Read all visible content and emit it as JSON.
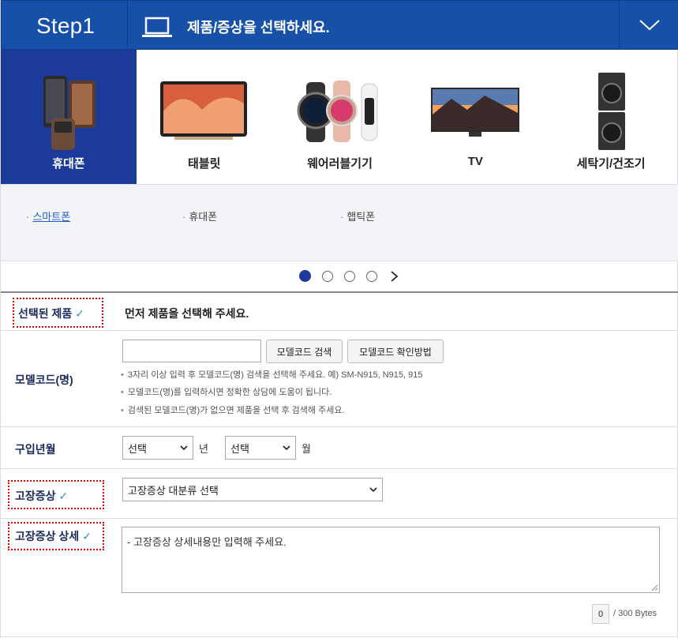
{
  "header": {
    "step": "Step1",
    "title": "제품/증상을 선택하세요.",
    "toggle_icon": "chevron-down-icon",
    "laptop_icon": "laptop-icon",
    "bg_color": "#1650a8"
  },
  "categories": [
    {
      "label": "휴대폰",
      "icon": "phone-image",
      "active": true
    },
    {
      "label": "태블릿",
      "icon": "tablet-image",
      "active": false
    },
    {
      "label": "웨어러블기기",
      "icon": "watch-image",
      "active": false
    },
    {
      "label": "TV",
      "icon": "tv-image",
      "active": false
    },
    {
      "label": "세탁기/건조기",
      "icon": "washer-image",
      "active": false
    }
  ],
  "subcategories": [
    {
      "label": "스마트폰",
      "selected": true
    },
    {
      "label": "휴대폰",
      "selected": false
    },
    {
      "label": "햅틱폰",
      "selected": false
    }
  ],
  "pagination": {
    "pages": 4,
    "current": 1,
    "next_icon": "chevron-right-icon"
  },
  "form": {
    "selected_product": {
      "label": "선택된 제품",
      "value": "먼저 제품을 선택해 주세요."
    },
    "model_code": {
      "label": "모델코드(명)",
      "input_value": "",
      "search_btn": "모델코드 검색",
      "howto_btn": "모델코드 확인방법",
      "notes": [
        "3자리 이상 입력 후 모델코드(명) 검색을 선택해 주세요. 예) SM-N915, N915, 915",
        "모델코드(명)를 입력하시면 정확한 상담에 도움이 됩니다.",
        "검색된 모델코드(명)가 없으면 제품을 선택 후 검색해 주세요."
      ]
    },
    "purchase_date": {
      "label": "구입년월",
      "year_value": "선택",
      "year_unit": "년",
      "month_value": "선택",
      "month_unit": "월"
    },
    "symptom": {
      "label": "고장증상",
      "value": "고장증상 대분류 선택"
    },
    "symptom_detail": {
      "label": "고장증상 상세",
      "placeholder": "- 고장증상 상세내용만 입력해 주세요.",
      "count": "0",
      "limit": "/ 300 Bytes"
    },
    "check_mark": "✓"
  }
}
